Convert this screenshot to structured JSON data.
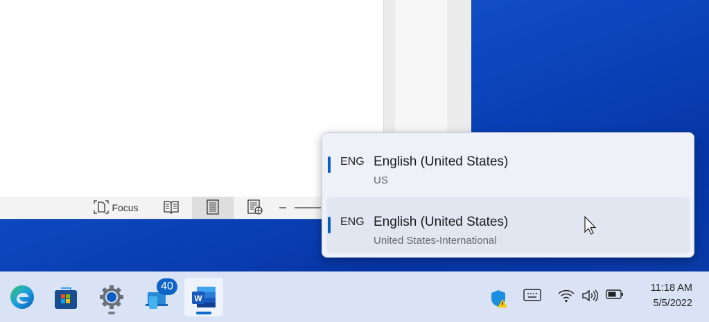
{
  "word_status": {
    "focus_label": "Focus",
    "views": [
      "read-mode",
      "print-layout",
      "web-layout"
    ]
  },
  "language_flyout": {
    "items": [
      {
        "code": "ENG",
        "language": "English (United States)",
        "keyboard": "US",
        "selected": true
      },
      {
        "code": "ENG",
        "language": "English (United States)",
        "keyboard": "United States-International",
        "hovered": true
      }
    ]
  },
  "taskbar": {
    "apps": [
      "Microsoft Edge",
      "Microsoft Store",
      "Settings",
      "Phone Link",
      "Word"
    ],
    "badge_count": "40",
    "active_app": "Word"
  },
  "tray": {
    "time": "11:18 AM",
    "date": "5/5/2022"
  },
  "colors": {
    "accent": "#0a5cc2",
    "taskbar": "#dae3f5",
    "wallpaper": "#0d47c0"
  }
}
